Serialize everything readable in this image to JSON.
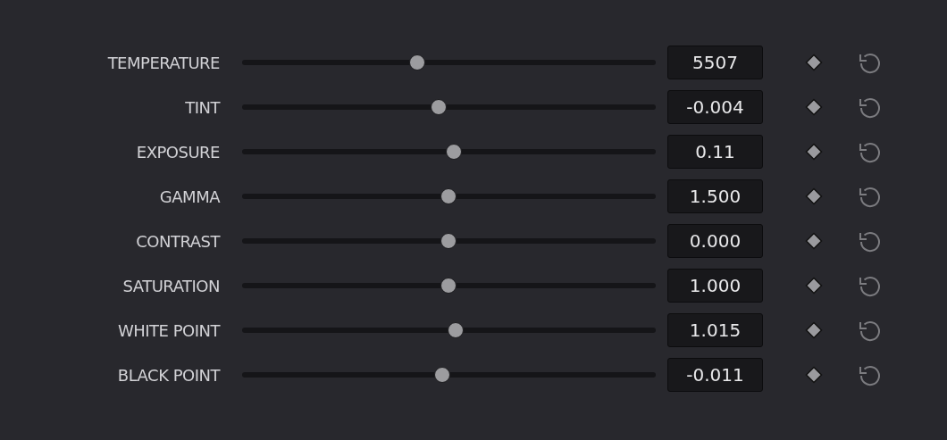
{
  "controls": [
    {
      "label": "TEMPERATURE",
      "level": 0.423,
      "value": "5507"
    },
    {
      "label": "TINT",
      "level": 0.475,
      "value": "-0.004"
    },
    {
      "label": "EXPOSURE",
      "level": 0.512,
      "value": "0.11"
    },
    {
      "label": "GAMMA",
      "level": 0.499,
      "value": "1.500"
    },
    {
      "label": "CONTRAST",
      "level": 0.499,
      "value": "0.000"
    },
    {
      "label": "SATURATION",
      "level": 0.499,
      "value": "1.000"
    },
    {
      "label": "WHITE POINT",
      "level": 0.516,
      "value": "1.015"
    },
    {
      "label": "BLACK POINT",
      "level": 0.484,
      "value": "-0.011"
    }
  ]
}
